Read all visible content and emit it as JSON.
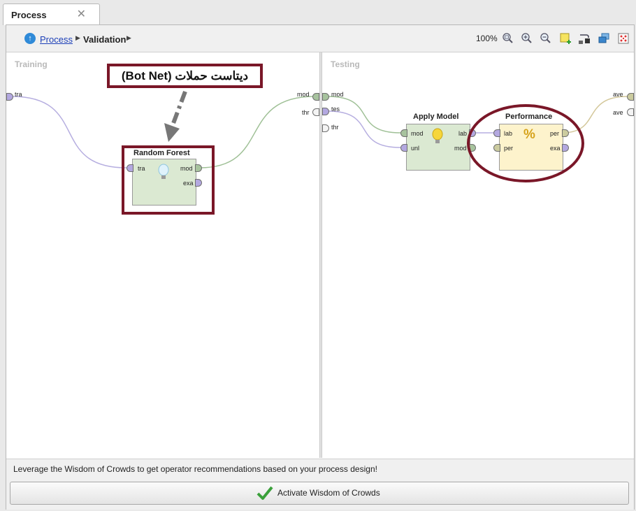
{
  "tab": {
    "label": "Process",
    "close": "✕"
  },
  "breadcrumb": {
    "process": "Process",
    "validation": "Validation",
    "arrow": "▶"
  },
  "zoom": {
    "level": "100%"
  },
  "left_panel": {
    "label": "Training",
    "ports_in": [
      "tra"
    ],
    "ports_out": [
      "mod",
      "thr"
    ]
  },
  "right_panel": {
    "label": "Testing",
    "ports_in": [
      "mod",
      "tes",
      "thr"
    ],
    "ports_out": [
      "ave",
      "ave"
    ]
  },
  "operators": {
    "random_forest": {
      "title": "Random Forest",
      "in": [
        "tra"
      ],
      "out": [
        "mod",
        "exa"
      ]
    },
    "apply_model": {
      "title": "Apply Model",
      "in": [
        "mod",
        "unl"
      ],
      "out": [
        "lab",
        "mod"
      ]
    },
    "performance": {
      "title": "Performance",
      "in": [
        "lab",
        "per"
      ],
      "out": [
        "per",
        "exa"
      ]
    }
  },
  "annotation": {
    "text": "(Bot Net) ديتاست حملات"
  },
  "footer": {
    "message": "Leverage the Wisdom of Crowds to get operator recommendations based on your process design!",
    "button_label": "Activate Wisdom of Crowds"
  },
  "colors": {
    "annotation_border": "#7a1728",
    "link": "#1c3fb8",
    "operator_green": "#dbe9d2",
    "operator_yellow": "#fdf3cc",
    "wire_purple": "#b6aee0",
    "wire_green": "#9fc096",
    "wire_khaki": "#d3c79a"
  }
}
